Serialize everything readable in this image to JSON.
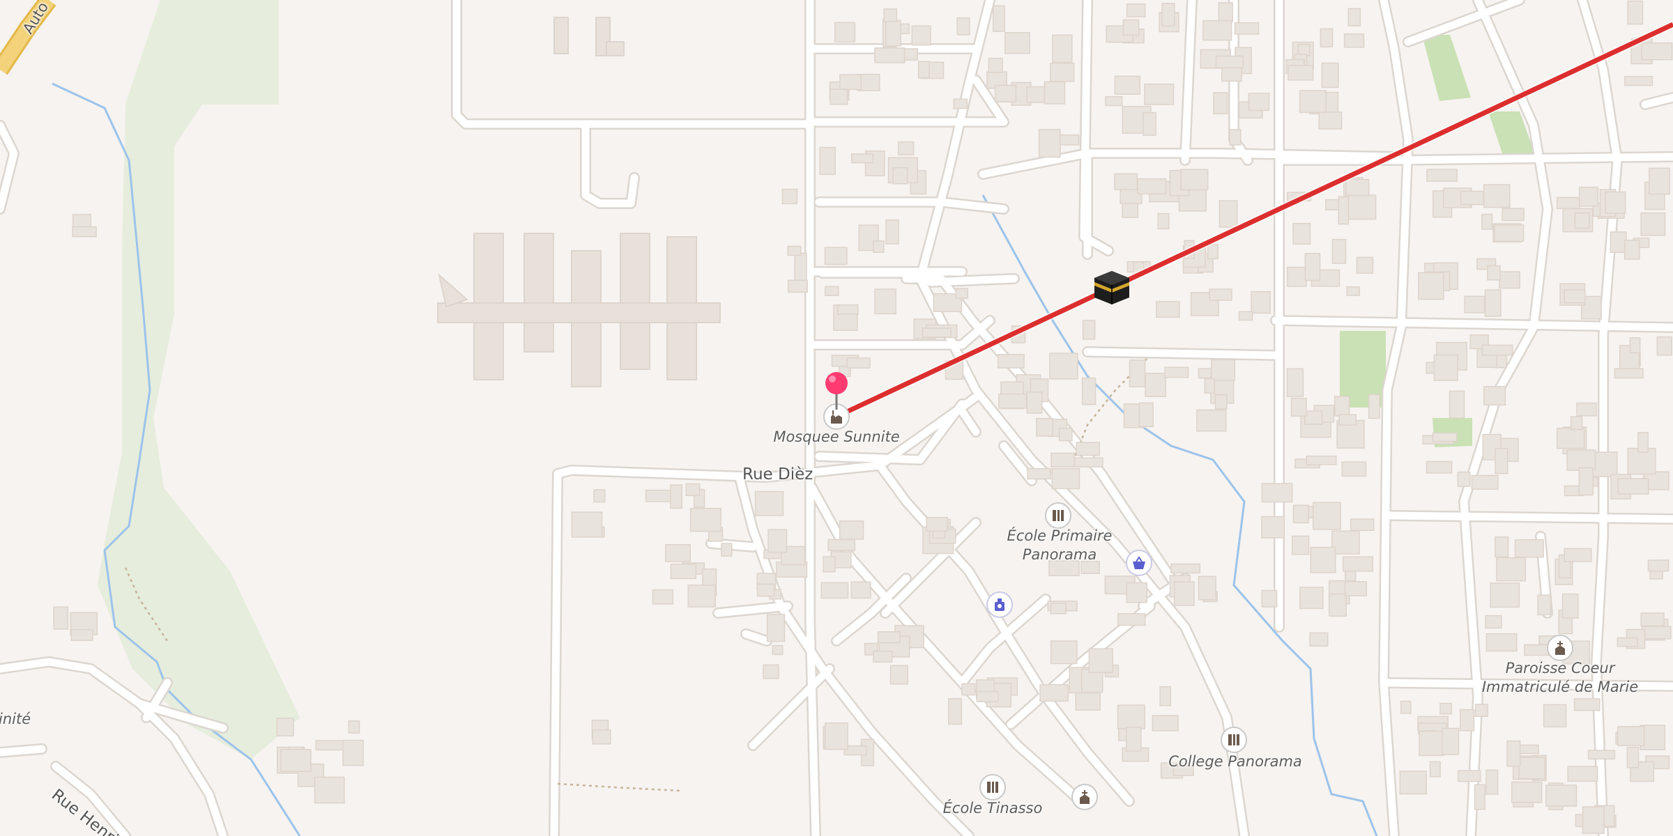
{
  "map": {
    "colors": {
      "background": "#f6f3f0",
      "building": "#e9e3dd",
      "road": "#ffffff",
      "road_casing": "#dcd6d0",
      "highway": "#f3d27a",
      "water": "#9cc3ea",
      "green": "#e6eddc",
      "park": "#c9e1b4",
      "route": "#dc2e2e",
      "pin": "#ff3b72",
      "poi_icon": "#6b5a4e",
      "shop_icon": "#5a5fd0"
    },
    "street_labels": [
      {
        "name": "street-rue-diez",
        "text": "Rue Dièz"
      },
      {
        "name": "street-rue-henri",
        "text": "Rue Henri"
      },
      {
        "name": "street-autoroute",
        "text": "Auto"
      },
      {
        "name": "label-trinite-partial",
        "text": "inité"
      }
    ],
    "pois": [
      {
        "name": "poi-mosquee-sunnite",
        "icon": "mosque-icon",
        "label": "Mosquee Sunnite"
      },
      {
        "name": "poi-ecole-primaire-panorama",
        "icon": "school-icon",
        "label": "École Primaire\nPanorama"
      },
      {
        "name": "poi-paroisse",
        "icon": "church-icon",
        "label": "Paroisse Coeur\nImmatriculé de Marie"
      },
      {
        "name": "poi-college-panorama",
        "icon": "school-icon",
        "label": "College Panorama"
      },
      {
        "name": "poi-ecole-tinasso",
        "icon": "school-icon",
        "label": "École Tinasso"
      },
      {
        "name": "poi-church-unlabeled",
        "icon": "church-icon",
        "label": ""
      },
      {
        "name": "poi-shop-basket",
        "icon": "shopping-basket-icon",
        "label": ""
      },
      {
        "name": "poi-shop-cosmetics",
        "icon": "cosmetics-icon",
        "label": ""
      }
    ],
    "route": {
      "start_marker": "map-pin-icon",
      "waypoint_marker": "kaaba-icon",
      "direction": "qibla"
    }
  }
}
